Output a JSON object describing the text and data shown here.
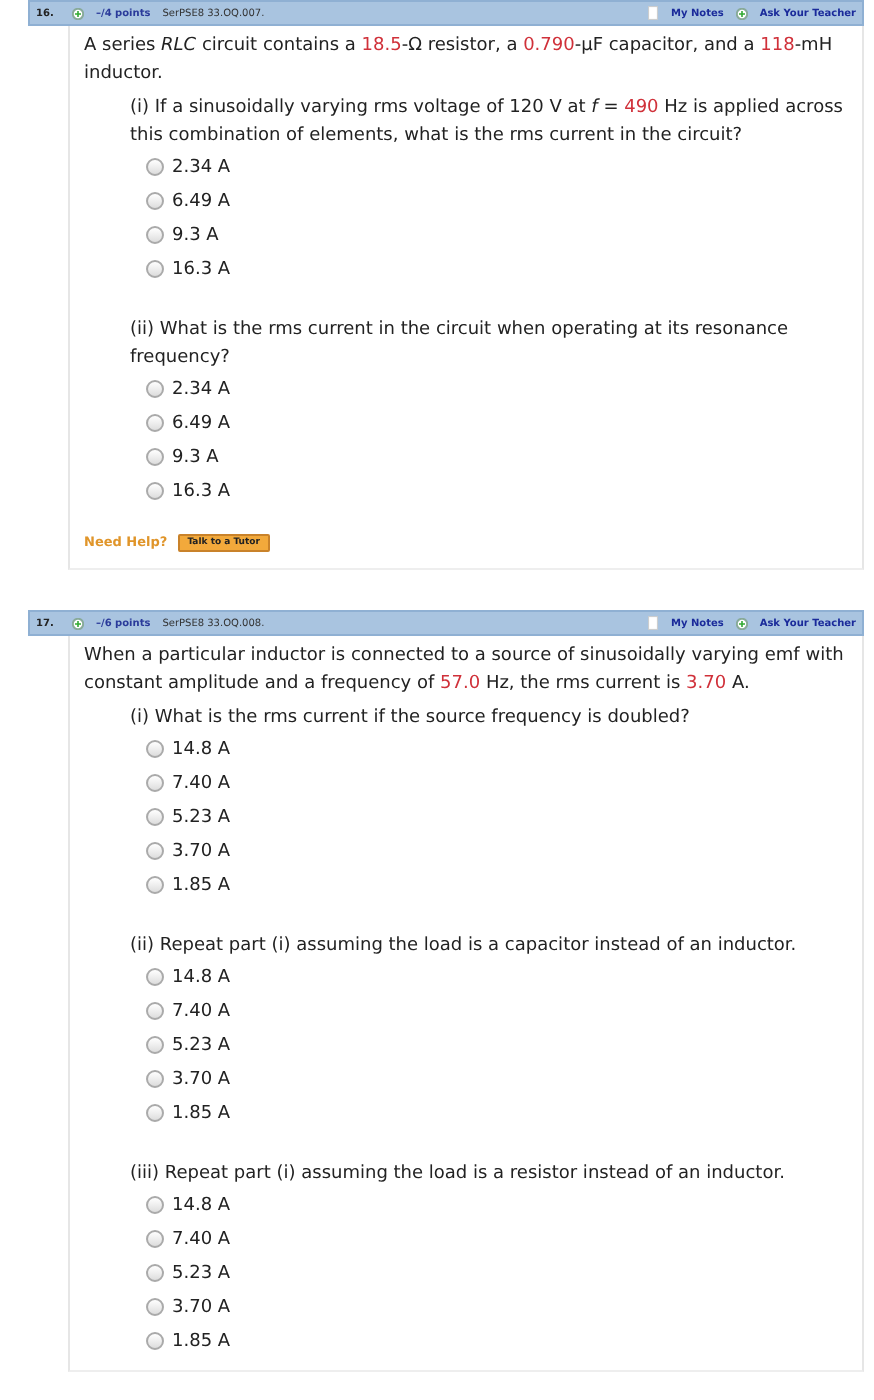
{
  "questions": [
    {
      "number": "16.",
      "points": "–/4 points",
      "code": "SerPSE8 33.OQ.007.",
      "notes": "My Notes",
      "ask": "Ask Your Teacher",
      "text": [
        {
          "kind": "plain",
          "text": "A series *RLC* circuit contains a "
        },
        {
          "kind": "value",
          "text": "18.5"
        },
        {
          "kind": "plain",
          "text": "-Ω resistor, a "
        },
        {
          "kind": "value",
          "text": "0.790"
        },
        {
          "kind": "plain",
          "text": "-µF capacitor, and a "
        },
        {
          "kind": "value",
          "text": "118"
        },
        {
          "kind": "plain",
          "text": "-mH inductor."
        }
      ],
      "parts": [
        {
          "text": [
            {
              "kind": "plain",
              "text": "(i) If a sinusoidally varying rms voltage of 120 V at *f* = "
            },
            {
              "kind": "value",
              "text": "490"
            },
            {
              "kind": "plain",
              "text": " Hz is applied across this combination of elements, what is the rms current in the circuit?"
            }
          ],
          "options": [
            {
              "label": "2.34 A",
              "selected": false
            },
            {
              "label": "6.49 A",
              "selected": false
            },
            {
              "label": "9.3 A",
              "selected": false
            },
            {
              "label": "16.3 A",
              "selected": false
            }
          ]
        },
        {
          "text": [
            {
              "kind": "plain",
              "text": "(ii) What is the rms current in the circuit when operating at its resonance frequency?"
            }
          ],
          "options": [
            {
              "label": "2.34 A",
              "selected": false
            },
            {
              "label": "6.49 A",
              "selected": false
            },
            {
              "label": "9.3 A",
              "selected": false
            },
            {
              "label": "16.3 A",
              "selected": false
            }
          ]
        }
      ],
      "help": {
        "label": "Need Help?",
        "button": "Talk to a Tutor"
      }
    },
    {
      "number": "17.",
      "points": "–/6 points",
      "code": "SerPSE8 33.OQ.008.",
      "notes": "My Notes",
      "ask": "Ask Your Teacher",
      "text": [
        {
          "kind": "plain",
          "text": "When a particular inductor is connected to a source of sinusoidally varying emf with constant amplitude and a frequency of "
        },
        {
          "kind": "value",
          "text": "57.0"
        },
        {
          "kind": "plain",
          "text": " Hz, the rms current is "
        },
        {
          "kind": "value",
          "text": "3.70"
        },
        {
          "kind": "plain",
          "text": " A."
        }
      ],
      "parts": [
        {
          "text": [
            {
              "kind": "plain",
              "text": "(i) What is the rms current if the source frequency is doubled?"
            }
          ],
          "options": [
            {
              "label": "14.8 A",
              "selected": false
            },
            {
              "label": "7.40 A",
              "selected": false
            },
            {
              "label": "5.23 A",
              "selected": false
            },
            {
              "label": "3.70 A",
              "selected": false
            },
            {
              "label": "1.85 A",
              "selected": false
            }
          ]
        },
        {
          "text": [
            {
              "kind": "plain",
              "text": "(ii) Repeat part (i) assuming the load is a capacitor instead of an inductor."
            }
          ],
          "options": [
            {
              "label": "14.8 A",
              "selected": false
            },
            {
              "label": "7.40 A",
              "selected": false
            },
            {
              "label": "5.23 A",
              "selected": false
            },
            {
              "label": "3.70 A",
              "selected": false
            },
            {
              "label": "1.85 A",
              "selected": false
            }
          ]
        },
        {
          "text": [
            {
              "kind": "plain",
              "text": "(iii) Repeat part (i) assuming the load is a resistor instead of an inductor."
            }
          ],
          "options": [
            {
              "label": "14.8 A",
              "selected": false
            },
            {
              "label": "7.40 A",
              "selected": false
            },
            {
              "label": "5.23 A",
              "selected": false
            },
            {
              "label": "3.70 A",
              "selected": false
            },
            {
              "label": "1.85 A",
              "selected": false
            }
          ]
        }
      ]
    }
  ]
}
